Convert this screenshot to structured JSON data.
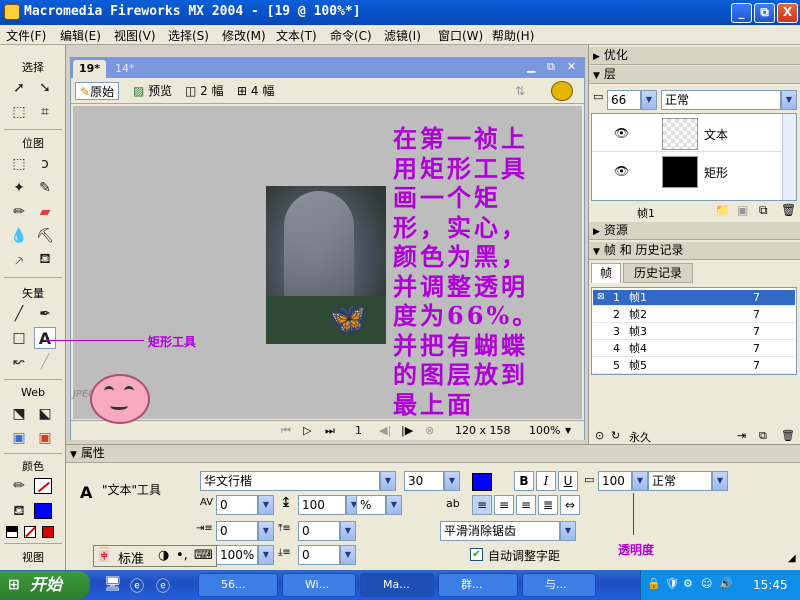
{
  "window": {
    "title": "Macromedia Fireworks MX 2004 - [19 @ 100%*]",
    "min_label": "_",
    "restore_label": "⧉",
    "close_label": "X"
  },
  "menu": [
    "文件(F)",
    "编辑(E)",
    "视图(V)",
    "选择(S)",
    "修改(M)",
    "文本(T)",
    "命令(C)",
    "滤镜(I)",
    "窗口(W)",
    "帮助(H)"
  ],
  "tools": {
    "select_label": "选择",
    "bitmap_label": "位图",
    "vector_label": "矢量",
    "web_label": "Web",
    "colors_label": "颜色",
    "view_label": "视图",
    "stroke_color": "#000000",
    "fill_color": "#0000ff"
  },
  "document": {
    "tabs": [
      "19*",
      "14*"
    ],
    "view_tabs": [
      "原始",
      "预览",
      "2 幅",
      "4 幅"
    ],
    "canvas_size": "120 x 158",
    "zoom": "100%",
    "frame": "1",
    "format": "JPEG"
  },
  "annotations": {
    "main_note": "在第一祯上用矩形工具画一个矩形，实心，颜色为黑，并调整透明度为66%。并把有蝴蝶的图层放到最上面",
    "rect_tool_note": "矩形工具",
    "opacity_note": "透明度"
  },
  "panels": {
    "optimize": "优化",
    "layers": "层",
    "opacity": "66",
    "blend_mode": "正常",
    "layer_items": [
      "文本",
      "矩形"
    ],
    "layer_footer": "帧1",
    "assets": "资源",
    "frames_history": "帧 和 历史记录",
    "tab_frames": "帧",
    "tab_history": "历史记录",
    "frames": [
      {
        "num": "1",
        "name": "帧1",
        "delay": "7"
      },
      {
        "num": "2",
        "name": "帧2",
        "delay": "7"
      },
      {
        "num": "3",
        "name": "帧3",
        "delay": "7"
      },
      {
        "num": "4",
        "name": "帧4",
        "delay": "7"
      },
      {
        "num": "5",
        "name": "帧5",
        "delay": "7"
      }
    ],
    "loop": "永久"
  },
  "properties": {
    "title": "属性",
    "tool_name": "\"文本\"工具",
    "font": "华文行楷",
    "size": "30",
    "kerning": "0",
    "leading": "100",
    "leading_unit": "%",
    "indent": "0",
    "space_before": "0",
    "space_after": "0",
    "horizontal_scale": "100%",
    "baseline": "0",
    "antialias": "平滑消除锯齿",
    "auto_kern": "自动调整字距",
    "opacity": "100",
    "blend": "正常",
    "bold": "B",
    "italic": "I",
    "underline": "U",
    "text_color": "#0000ff"
  },
  "ime": {
    "label": "标准"
  },
  "taskbar": {
    "start": "开始",
    "tasks": [
      "56...",
      "Wi...",
      "Ma...",
      "群...",
      "与..."
    ],
    "clock": "15:45"
  }
}
